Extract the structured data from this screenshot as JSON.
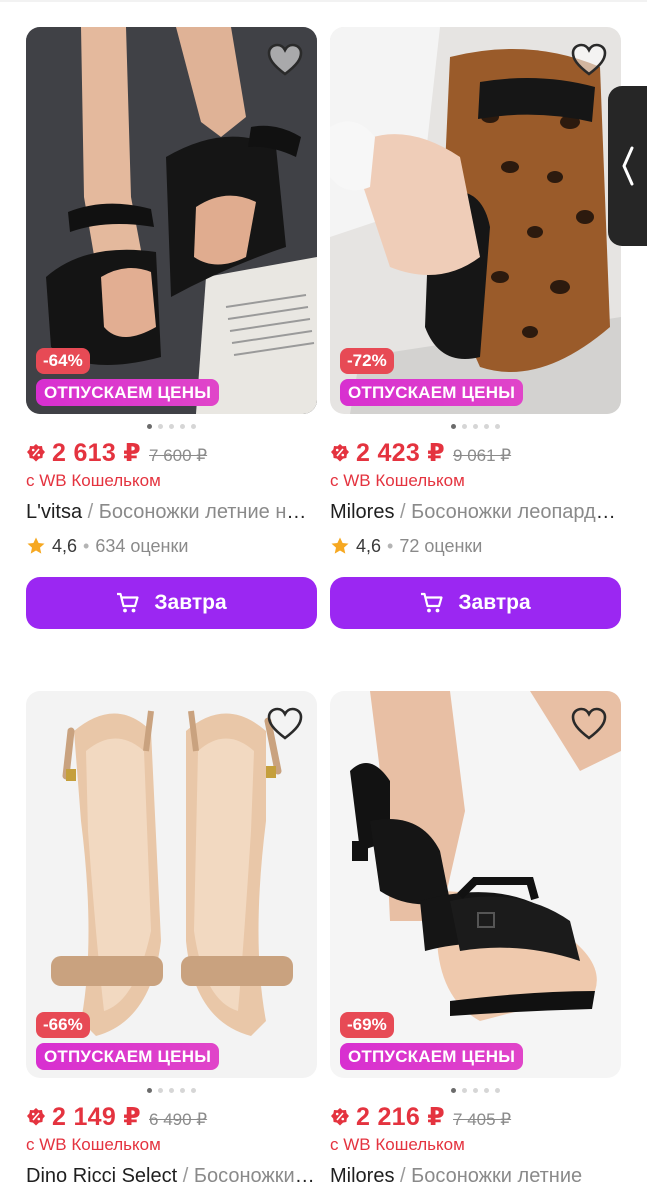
{
  "promo_label": "ОТПУСКАЕМ ЦЕНЫ",
  "colors": {
    "price": "#e4333f",
    "button": "#9b27f2",
    "promo": "#d82fd0",
    "discount": "#e74a55"
  },
  "products": [
    {
      "discount": "-64%",
      "price": "2 613 ₽",
      "old_price": "7 600 ₽",
      "wallet": "с WB Кошельком",
      "brand": "L'vitsa",
      "sep": " / ",
      "name": "Босоножки летние на платформе",
      "rating": "4,6",
      "reviews": "634 оценки",
      "button": "Завтра",
      "active_slide": 0,
      "slides": 5
    },
    {
      "discount": "-72%",
      "price": "2 423 ₽",
      "old_price": "9 061 ₽",
      "wallet": "с WB Кошельком",
      "brand": "Milores",
      "sep": " / ",
      "name": "Босоножки леопардовые",
      "rating": "4,6",
      "reviews": "72 оценки",
      "button": "Завтра",
      "active_slide": 0,
      "slides": 5
    },
    {
      "discount": "-66%",
      "price": "2 149 ₽",
      "old_price": "6 490 ₽",
      "wallet": "с WB Кошельком",
      "brand": "Dino Ricci Select",
      "sep": " / ",
      "name": "Босоножки на каблуке",
      "active_slide": 0,
      "slides": 5
    },
    {
      "discount": "-69%",
      "price": "2 216 ₽",
      "old_price": "7 405 ₽",
      "wallet": "с WB Кошельком",
      "brand": "Milores",
      "sep": " / ",
      "name": "Босоножки летние",
      "active_slide": 0,
      "slides": 5
    }
  ],
  "icons": {
    "favorite": "heart-icon",
    "cart": "cart-icon",
    "rating": "star-icon",
    "discount_price": "percent-badge-icon",
    "side_tab": "chevron-left-icon"
  }
}
